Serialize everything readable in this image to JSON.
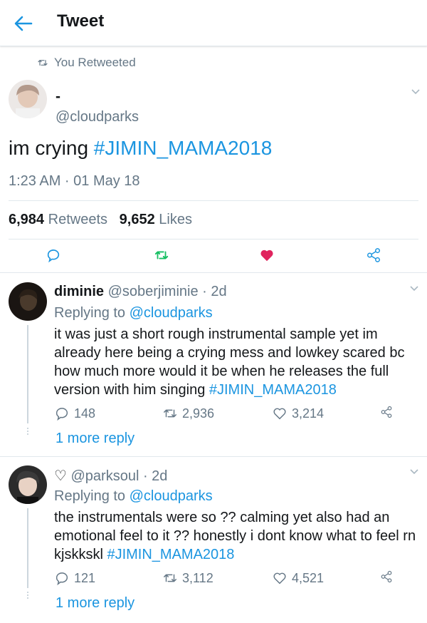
{
  "header": {
    "title": "Tweet"
  },
  "retweet_context": {
    "label": "You Retweeted"
  },
  "tweet": {
    "name": "-",
    "handle": "@cloudparks",
    "text_before": "im crying ",
    "hashtag": "#JIMIN_MAMA2018",
    "timestamp": "1:23 AM · 01 May 18",
    "retweets_count": "6,984",
    "retweets_label": "Retweets",
    "likes_count": "9,652",
    "likes_label": "Likes"
  },
  "replies": [
    {
      "name": "diminie",
      "handle_time": "@soberjiminie · 2d",
      "replying_prefix": "Replying to ",
      "replying_to": "@cloudparks",
      "text": "it was just a short rough instrumental sample yet im already here being a crying mess and lowkey scared bc how much more would it be when he releases the full version with him singing ",
      "hashtag": "#JIMIN_MAMA2018",
      "reply_count": "148",
      "retweet_count": "2,936",
      "like_count": "3,214",
      "more_replies": "1 more reply"
    },
    {
      "name": "♡",
      "handle_time": "@parksoul · 2d",
      "replying_prefix": "Replying to ",
      "replying_to": "@cloudparks",
      "text": "the instrumentals were so ?? calming yet also had an emotional feel to it ?? honestly i dont know what to feel rn kjskkskl ",
      "hashtag": "#JIMIN_MAMA2018",
      "reply_count": "121",
      "retweet_count": "3,112",
      "like_count": "4,521",
      "more_replies": "1 more reply"
    }
  ],
  "colors": {
    "link": "#1b95e0",
    "muted": "#657786",
    "retweet_green": "#17bf63",
    "like_red": "#e0245e",
    "divider": "#e1e8ed"
  }
}
